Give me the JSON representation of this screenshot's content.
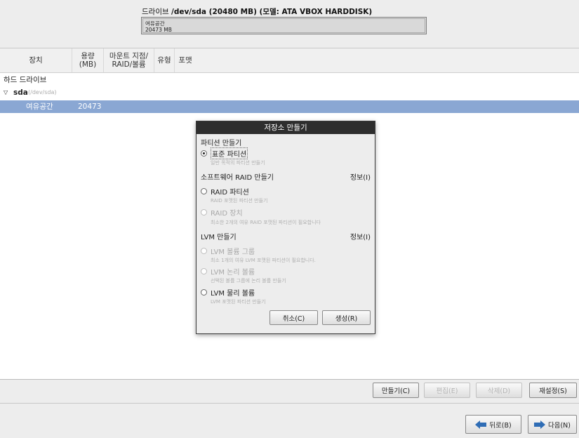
{
  "drive": {
    "title_prefix": "드라이브",
    "title_main": "/dev/sda (20480 MB) (모델: ATA VBOX HARDDISK)",
    "bar_line1": "여유공간",
    "bar_line2": "20473 MB"
  },
  "table": {
    "headers": [
      "장치",
      "용량\n(MB)",
      "마운트 지점/\nRAID/볼륨",
      "유형",
      "포맷"
    ],
    "group_label": "하드 드라이브",
    "device_name": "sda",
    "device_path": "(/dev/sda)",
    "free_label": "여유공간",
    "free_size": "20473"
  },
  "dialog": {
    "title": "저장소 만들기",
    "section_partition": "파티션 만들기",
    "opt_standard": "표준 파티션",
    "hint_standard": "일반 목적의 파티션 만들기",
    "section_raid": "소프트웨어 RAID 만들기",
    "info_raid": "정보(I)",
    "opt_raid_partition": "RAID 파티션",
    "hint_raid_partition": "RAID 포맷된 파티션 만들기",
    "opt_raid_device": "RAID 장치",
    "hint_raid_device": "최소한 2개의 여유 RAID 포맷된 파티션이 필요합니다",
    "section_lvm": "LVM 만들기",
    "info_lvm": "정보(I)",
    "opt_lvm_vg": "LVM 볼륨 그룹",
    "hint_lvm_vg": "최소 1개의 여유 LVM 포맷된 파티션이 필요합니다.",
    "opt_lvm_lv": "LVM 논리 볼륨",
    "hint_lvm_lv": "선택된 볼륨 그룹에 논리 볼륨 만들기",
    "opt_lvm_pv": "LVM 물리 볼륨",
    "hint_lvm_pv": "LVM 포맷된 파티션 만들기",
    "cancel": "취소(C)",
    "create": "생성(R)"
  },
  "actions": {
    "create": "만들기(C)",
    "edit": "편집(E)",
    "delete": "삭제(D)",
    "reset": "재설정(S)"
  },
  "nav": {
    "back": "뒤로(B)",
    "next": "다음(N)"
  },
  "colors": {
    "selection": "#8aa7d3",
    "arrow": "#2f6db5"
  }
}
